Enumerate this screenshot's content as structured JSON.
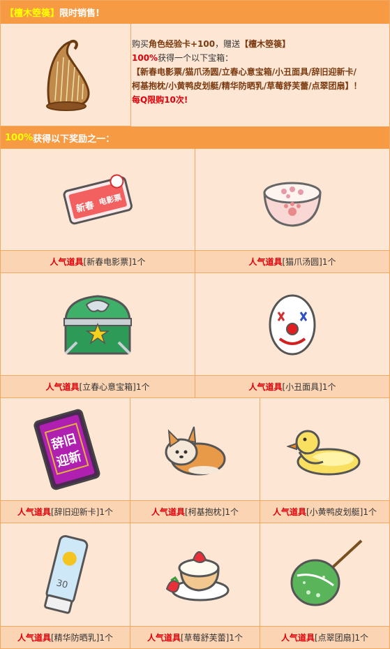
{
  "promo": {
    "title_bracket": "【檀木箜篌】",
    "title_rest": "限时销售!",
    "line1_a": "购买",
    "line1_b": "角色经验卡+100",
    "line1_c": "，赠送",
    "line1_d": "【檀木箜篌】",
    "line2_a": "100%",
    "line2_b": "获得一个以下宝箱：",
    "line3": "【新春电影票/猫爪汤圆/立春心意宝箱/小丑面具/辞旧迎新卡/",
    "line4": "柯基抱枕/小黄鸭皮划艇/精华防晒乳/草莓舒芙蕾/点翠团扇】！",
    "line5": "每Q限购10次!"
  },
  "rewards_header": {
    "pct": "100%",
    "text": "获得以下奖励之一："
  },
  "items": [
    {
      "key": "人气道具",
      "name": "[新春电影票]1个",
      "icon": "movie-ticket-icon",
      "art": [
        "新春",
        "电影票"
      ]
    },
    {
      "key": "人气道具",
      "name": "[猫爪汤圆]1个",
      "icon": "cat-paw-soup-icon"
    },
    {
      "key": "人气道具",
      "name": "[立春心意宝箱]1个",
      "icon": "treasure-chest-icon"
    },
    {
      "key": "人气道具",
      "name": "[小丑面具]1个",
      "icon": "clown-mask-icon"
    },
    {
      "key": "人气道具",
      "name": "[辞旧迎新卡]1个",
      "icon": "new-year-card-icon",
      "art": [
        "辞旧",
        "迎新"
      ]
    },
    {
      "key": "人气道具",
      "name": "[柯基抱枕]1个",
      "icon": "corgi-pillow-icon"
    },
    {
      "key": "人气道具",
      "name": "[小黄鸭皮划艇]1个",
      "icon": "rubber-duck-icon"
    },
    {
      "key": "人气道具",
      "name": "[精华防晒乳]1个",
      "icon": "sunscreen-icon",
      "art": [
        "30"
      ]
    },
    {
      "key": "人气道具",
      "name": "[草莓舒芙蕾]1个",
      "icon": "strawberry-souffle-icon"
    },
    {
      "key": "人气道具",
      "name": "[点翠团扇]1个",
      "icon": "round-fan-icon"
    }
  ]
}
